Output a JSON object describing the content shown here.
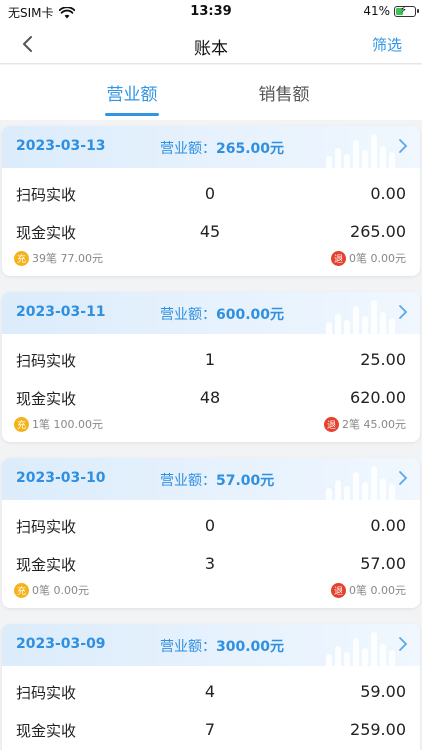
{
  "status_bar": {
    "carrier": "无SIM卡",
    "time": "13:39",
    "battery_percent": "41%",
    "battery_level": 0.41
  },
  "nav": {
    "title": "账本",
    "action": "筛选"
  },
  "tabs": [
    {
      "label": "营业额",
      "active": true
    },
    {
      "label": "销售额",
      "active": false
    }
  ],
  "total_prefix": "营业额：",
  "rows_labels": {
    "scan": "扫码实收",
    "cash": "现金实收"
  },
  "badges": {
    "charge": "充",
    "refund": "退"
  },
  "cards": [
    {
      "date": "2023-03-13",
      "total": "265.00元",
      "scan": {
        "count": "0",
        "amount": "0.00"
      },
      "cash": {
        "count": "45",
        "amount": "265.00"
      },
      "charge_text": "39笔 77.00元",
      "refund_text": "0笔 0.00元"
    },
    {
      "date": "2023-03-11",
      "total": "600.00元",
      "scan": {
        "count": "1",
        "amount": "25.00"
      },
      "cash": {
        "count": "48",
        "amount": "620.00"
      },
      "charge_text": "1笔 100.00元",
      "refund_text": "2笔 45.00元"
    },
    {
      "date": "2023-03-10",
      "total": "57.00元",
      "scan": {
        "count": "0",
        "amount": "0.00"
      },
      "cash": {
        "count": "3",
        "amount": "57.00"
      },
      "charge_text": "0笔 0.00元",
      "refund_text": "0笔 0.00元"
    },
    {
      "date": "2023-03-09",
      "total": "300.00元",
      "scan": {
        "count": "4",
        "amount": "59.00"
      },
      "cash": {
        "count": "7",
        "amount": "259.00"
      },
      "charge_text": "",
      "refund_text": ""
    }
  ],
  "colors": {
    "accent": "#2f95e4",
    "charge_badge": "#f5b31b",
    "refund_badge": "#e5412c",
    "battery_fill": "#3cc35a"
  },
  "icons": [
    "wifi-icon",
    "battery-icon",
    "back-arrow-icon",
    "chevron-right-icon"
  ]
}
